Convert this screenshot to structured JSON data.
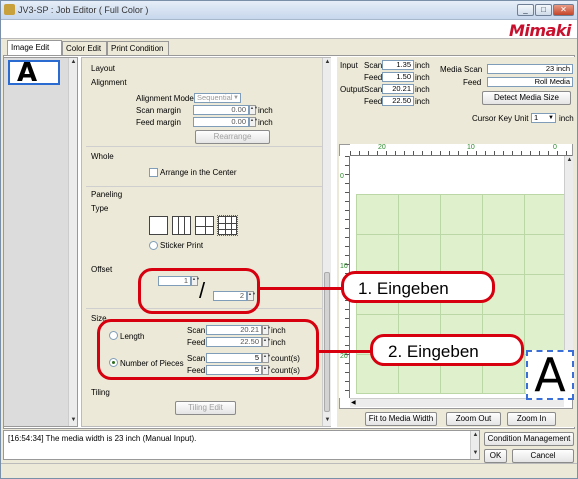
{
  "window": {
    "title": "JV3-SP : Job Editor ( Full Color )",
    "brand": "Mimaki"
  },
  "tabs": [
    {
      "label": "Image Edit"
    },
    {
      "label": "Color Edit"
    },
    {
      "label": "Print Condition"
    }
  ],
  "thumbnail": {
    "glyph": "A"
  },
  "layout": {
    "section": "Layout",
    "alignment_label": "Alignment",
    "alignment_mode_label": "Alignment Mode",
    "alignment_mode_value": "Sequential",
    "scan_margin_label": "Scan margin",
    "scan_margin_value": "0.00",
    "feed_margin_label": "Feed margin",
    "feed_margin_value": "0.00",
    "unit": "inch",
    "rearrange_label": "Rearrange"
  },
  "whole": {
    "label": "Whole",
    "arrange_center_label": "Arrange in the Center"
  },
  "paneling": {
    "label": "Paneling",
    "type_label": "Type",
    "sticker_print_label": "Sticker Print",
    "offset_label": "Offset",
    "offset_x": "1",
    "offset_y": "2",
    "slash": "/",
    "size_label": "Size",
    "length_label": "Length",
    "number_of_pieces_label": "Number of Pieces",
    "scan_label": "Scan",
    "feed_label": "Feed",
    "length_scan_value": "20.21",
    "length_feed_value": "22.50",
    "pieces_scan_value": "5",
    "pieces_feed_value": "5",
    "count_unit": "count(s)",
    "unit": "inch",
    "tiling_label": "Tiling",
    "tiling_edit_label": "Tiling Edit"
  },
  "info": {
    "input_label": "Input",
    "output_label": "Output",
    "scan_label": "Scan",
    "feed_label": "Feed",
    "input_scan_value": "1.35",
    "input_feed_value": "1.50",
    "output_scan_value": "20.21",
    "output_feed_value": "22.50",
    "unit": "inch",
    "media_scan_label": "Media Scan",
    "media_scan_value": "23 inch",
    "media_feed_label": "Feed",
    "media_feed_value": "Roll Media",
    "detect_media_size_label": "Detect Media Size",
    "cursor_key_unit_label": "Cursor Key Unit",
    "cursor_key_unit_value": "1",
    "cursor_key_unit_suffix": "inch"
  },
  "ruler": {
    "h_ticks": [
      "20",
      "10",
      "0"
    ],
    "v_ticks": [
      "0",
      "10",
      "20"
    ]
  },
  "preview": {
    "glyph": "A"
  },
  "buttons": {
    "fit_to_media_width": "Fit to Media Width",
    "zoom_out": "Zoom Out",
    "zoom_in": "Zoom In",
    "condition_management": "Condition Management",
    "ok": "OK",
    "cancel": "Cancel"
  },
  "message": "[16:54:34] The media width is 23 inch (Manual Input).",
  "callouts": {
    "one": "1. Eingeben",
    "two": "2. Eingeben"
  },
  "colors": {
    "callout": "#d6000f",
    "media": "#dff0cc",
    "accent": "#2a6bd1"
  }
}
